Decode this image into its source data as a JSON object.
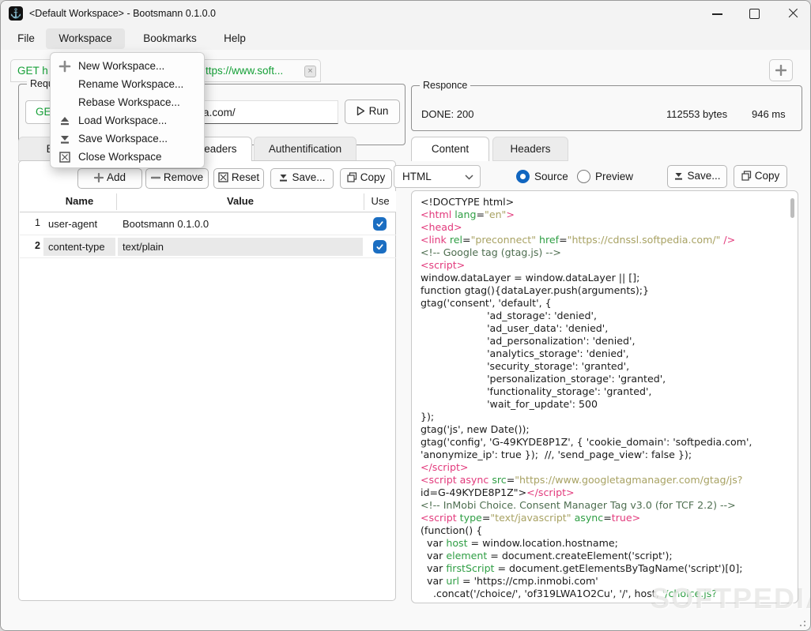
{
  "window": {
    "title": "<Default Workspace> - Bootsmann 0.1.0.0",
    "app_icon": "anchor-icon"
  },
  "menubar": {
    "items": [
      {
        "label": "File"
      },
      {
        "label": "Workspace",
        "active": true
      },
      {
        "label": "Bookmarks"
      },
      {
        "label": "Help"
      }
    ]
  },
  "workspace_menu": {
    "items": [
      {
        "label": "New Workspace...",
        "icon": "plus-icon"
      },
      {
        "label": "Rename Workspace...",
        "icon": ""
      },
      {
        "label": "Rebase Workspace...",
        "icon": ""
      },
      {
        "label": "Load Workspace...",
        "icon": "eject-icon"
      },
      {
        "label": "Save Workspace...",
        "icon": "save-icon"
      },
      {
        "label": "Close Workspace",
        "icon": "close-box-icon"
      }
    ]
  },
  "request_tabbar": {
    "label": "GET https://www.soft...",
    "label_left": "GET h",
    "label_right": "ttps://www.soft...",
    "close": "×"
  },
  "request_panel": {
    "group_label": "Request",
    "method": "GET",
    "url": "https://www.softpedia.com/",
    "run_label": "Run",
    "tabs": [
      {
        "label": "Body"
      },
      {
        "label": "Headers",
        "active": true
      },
      {
        "label": "Authentification"
      }
    ],
    "toolbar": {
      "add": "Add",
      "remove": "Remove",
      "reset": "Reset",
      "save": "Save...",
      "copy": "Copy"
    },
    "table": {
      "headers": [
        "Name",
        "Value",
        "Use"
      ],
      "rows": [
        {
          "num": "1",
          "name": "user-agent",
          "value": "Bootsmann 0.1.0.0",
          "use": true,
          "selected": false
        },
        {
          "num": "2",
          "name": "content-type",
          "value": "text/plain",
          "use": true,
          "selected": true
        }
      ]
    }
  },
  "response_panel": {
    "group_label": "Responce",
    "status": "DONE: 200",
    "bytes": "112553 bytes",
    "time": "946 ms",
    "tabs": [
      {
        "label": "Content",
        "active": true
      },
      {
        "label": "Headers",
        "active": false
      }
    ],
    "format_select": "HTML",
    "view_options": [
      {
        "label": "Source",
        "selected": true
      },
      {
        "label": "Preview",
        "selected": false
      }
    ],
    "save_label": "Save...",
    "copy_label": "Copy",
    "code_lines": [
      [
        [
          "p",
          "<!DOCTYPE html>"
        ]
      ],
      [
        [
          "t",
          "<html"
        ],
        [
          "p",
          " "
        ],
        [
          "a",
          "lang"
        ],
        [
          "p",
          "="
        ],
        [
          "v",
          "\"en\""
        ],
        [
          "t",
          ">"
        ]
      ],
      [
        [
          "t",
          "<head>"
        ]
      ],
      [
        [
          "t",
          "<link"
        ],
        [
          "p",
          " "
        ],
        [
          "a",
          "rel"
        ],
        [
          "p",
          "="
        ],
        [
          "v",
          "\"preconnect\""
        ],
        [
          "p",
          " "
        ],
        [
          "a",
          "href"
        ],
        [
          "p",
          "="
        ],
        [
          "v",
          "\"https://cdnssl.softpedia.com/\""
        ],
        [
          "t",
          " />"
        ]
      ],
      [
        [
          "c",
          "<!-- Google tag (gtag.js) -->"
        ]
      ],
      [
        [
          "t",
          "<script>"
        ]
      ],
      [
        [
          "p",
          "window.dataLayer = window.dataLayer || [];"
        ]
      ],
      [
        [
          "p",
          "function gtag(){dataLayer.push(arguments);}"
        ]
      ],
      [
        [
          "p",
          "gtag('consent', 'default', {"
        ]
      ],
      [
        [
          "p",
          "                     'ad_storage': 'denied',"
        ]
      ],
      [
        [
          "p",
          "                     'ad_user_data': 'denied',"
        ]
      ],
      [
        [
          "p",
          "                     'ad_personalization': 'denied',"
        ]
      ],
      [
        [
          "p",
          "                     'analytics_storage': 'denied',"
        ]
      ],
      [
        [
          "p",
          "                     'security_storage': 'granted',"
        ]
      ],
      [
        [
          "p",
          "                     'personalization_storage': 'granted',"
        ]
      ],
      [
        [
          "p",
          "                     'functionality_storage': 'granted',"
        ]
      ],
      [
        [
          "p",
          "                     'wait_for_update': 500"
        ]
      ],
      [
        [
          "p",
          "});"
        ]
      ],
      [
        [
          "p",
          "gtag('js', new Date());"
        ]
      ],
      [
        [
          "p",
          "gtag('config', 'G-49KYDE8P1Z', { 'cookie_domain': 'softpedia.com',"
        ]
      ],
      [
        [
          "p",
          "'anonymize_ip': true });  //, 'send_page_view': false });"
        ]
      ],
      [
        [
          "t",
          "</script>"
        ]
      ],
      [
        [
          "t",
          "<script async"
        ],
        [
          "p",
          " "
        ],
        [
          "a",
          "src"
        ],
        [
          "p",
          "="
        ],
        [
          "v",
          "\"https://www.googletagmanager.com/gtag/js?"
        ]
      ],
      [
        [
          "p",
          "id=G-49KYDE8P1Z\">"
        ],
        [
          "t",
          "</script>"
        ]
      ],
      [
        [
          "c",
          "<!-- InMobi Choice. Consent Manager Tag v3.0 (for TCF 2.2) -->"
        ]
      ],
      [
        [
          "t",
          "<script"
        ],
        [
          "p",
          " "
        ],
        [
          "a",
          "type"
        ],
        [
          "p",
          "="
        ],
        [
          "v",
          "\"text/javascript\""
        ],
        [
          "p",
          " "
        ],
        [
          "a",
          "async"
        ],
        [
          "p",
          "="
        ],
        [
          "t",
          "true>"
        ]
      ],
      [
        [
          "p",
          "(function() {"
        ]
      ],
      [
        [
          "p",
          "  var "
        ],
        [
          "a",
          "host"
        ],
        [
          "p",
          " = window.location.hostname;"
        ]
      ],
      [
        [
          "p",
          "  var "
        ],
        [
          "a",
          "element"
        ],
        [
          "p",
          " = document.createElement('script');"
        ]
      ],
      [
        [
          "p",
          "  var "
        ],
        [
          "a",
          "firstScript"
        ],
        [
          "p",
          " = document.getElementsByTagName('script')[0];"
        ]
      ],
      [
        [
          "p",
          "  var "
        ],
        [
          "a",
          "url"
        ],
        [
          "p",
          " = 'https://cmp.inmobi.com'"
        ]
      ],
      [
        [
          "p",
          "    .concat('/choice/', 'of319LWA1O2Cu', '/', host, "
        ],
        [
          "a",
          "'/choice.js?"
        ]
      ]
    ]
  },
  "watermark": "SOFTPEDIA",
  "colors": {
    "accent_green": "#16a038",
    "tag_pink": "#e23a7c",
    "attr_green": "#2f9e44",
    "value_olive": "#a8a263",
    "comment_green": "#4e6e50",
    "checkbox_blue": "#1b6ec2",
    "radio_blue": "#1166c0"
  }
}
